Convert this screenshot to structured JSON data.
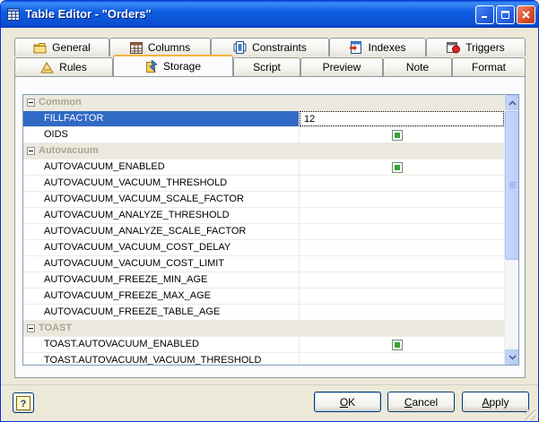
{
  "window": {
    "title": "Table Editor - \"Orders\""
  },
  "tabs_top": [
    {
      "label": "General",
      "icon": "folder-icon"
    },
    {
      "label": "Columns",
      "icon": "columns-icon"
    },
    {
      "label": "Constraints",
      "icon": "constraints-icon"
    },
    {
      "label": "Indexes",
      "icon": "index-icon"
    },
    {
      "label": "Triggers",
      "icon": "trigger-icon"
    }
  ],
  "tabs_bottom": [
    {
      "label": "Rules",
      "icon": "rules-icon"
    },
    {
      "label": "Storage",
      "icon": "storage-icon",
      "active": true
    },
    {
      "label": "Script"
    },
    {
      "label": "Preview"
    },
    {
      "label": "Note"
    },
    {
      "label": "Format"
    }
  ],
  "grid": {
    "rows": [
      {
        "type": "category",
        "label": "Common"
      },
      {
        "type": "property",
        "name": "FILLFACTOR",
        "value": "12",
        "selected": true
      },
      {
        "type": "property",
        "name": "OIDS",
        "checked": true
      },
      {
        "type": "category",
        "label": "Autovacuum"
      },
      {
        "type": "property",
        "name": "AUTOVACUUM_ENABLED",
        "checked": true
      },
      {
        "type": "property",
        "name": "AUTOVACUUM_VACUUM_THRESHOLD",
        "value": ""
      },
      {
        "type": "property",
        "name": "AUTOVACUUM_VACUUM_SCALE_FACTOR",
        "value": ""
      },
      {
        "type": "property",
        "name": "AUTOVACUUM_ANALYZE_THRESHOLD",
        "value": ""
      },
      {
        "type": "property",
        "name": "AUTOVACUUM_ANALYZE_SCALE_FACTOR",
        "value": ""
      },
      {
        "type": "property",
        "name": "AUTOVACUUM_VACUUM_COST_DELAY",
        "value": ""
      },
      {
        "type": "property",
        "name": "AUTOVACUUM_VACUUM_COST_LIMIT",
        "value": ""
      },
      {
        "type": "property",
        "name": "AUTOVACUUM_FREEZE_MIN_AGE",
        "value": ""
      },
      {
        "type": "property",
        "name": "AUTOVACUUM_FREEZE_MAX_AGE",
        "value": ""
      },
      {
        "type": "property",
        "name": "AUTOVACUUM_FREEZE_TABLE_AGE",
        "value": ""
      },
      {
        "type": "category",
        "label": "TOAST"
      },
      {
        "type": "property",
        "name": "TOAST.AUTOVACUUM_ENABLED",
        "checked": true
      },
      {
        "type": "property",
        "name": "TOAST.AUTOVACUUM_VACUUM_THRESHOLD",
        "value": ""
      }
    ]
  },
  "buttons": {
    "ok": {
      "accel": "O",
      "rest": "K"
    },
    "cancel": {
      "accel": "C",
      "rest": "ancel"
    },
    "apply": {
      "accel": "A",
      "rest": "pply"
    },
    "help": "?"
  },
  "colors": {
    "titlebar": "#0A4FD0",
    "selection": "#316AC5",
    "active_tab_highlight": "#F5B341",
    "checkbox_fill": "#3BA03B"
  }
}
